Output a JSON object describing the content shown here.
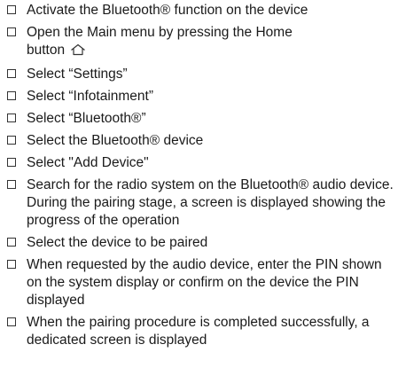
{
  "steps": [
    {
      "text": "Activate the Bluetooth® function on the device"
    },
    {
      "text": "Open the Main menu by pressing the Home button",
      "icon": "home-icon"
    },
    {
      "text": "Select “Settings”"
    },
    {
      "text": "Select “Infotainment”"
    },
    {
      "text": "Select “Bluetooth®”"
    },
    {
      "text": "Select the Bluetooth® device"
    },
    {
      "text": "Select \"Add Device\""
    },
    {
      "text": "Search for the radio system on the Bluetooth® audio device. During the pairing stage, a screen is displayed showing the progress of the operation"
    },
    {
      "text": "Select the device to be paired"
    },
    {
      "text": "When requested by the audio device, enter the PIN shown on the system display or confirm on the device the PIN displayed"
    },
    {
      "text": "When the pairing procedure is completed successfully, a dedicated screen is displayed"
    }
  ]
}
